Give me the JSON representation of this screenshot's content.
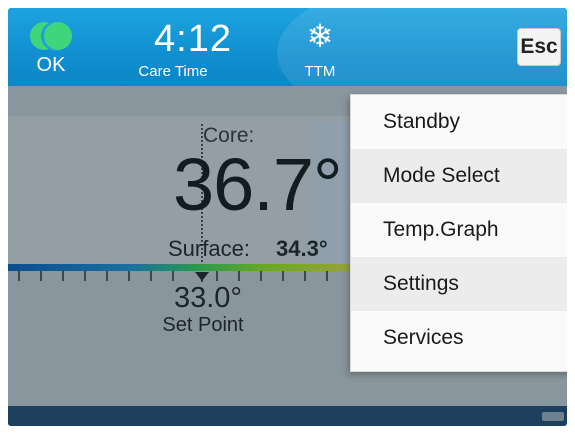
{
  "header": {
    "status_label": "OK",
    "care_time": "4:12",
    "care_time_label": "Care Time",
    "mode_icon": "snowflake-icon",
    "mode_symbol": "❄",
    "mode_label": "TTM",
    "esc_label": "Esc"
  },
  "temps": {
    "core_label": "Core:",
    "core_value": "36.7°",
    "surface_label": "Surface:",
    "surface_value": "34.3°",
    "setpoint_value": "33.0°",
    "setpoint_label": "Set Point"
  },
  "menu": {
    "items": [
      {
        "label": "Standby"
      },
      {
        "label": "Mode Select"
      },
      {
        "label": "Temp.Graph"
      },
      {
        "label": "Settings"
      },
      {
        "label": "Services"
      }
    ]
  },
  "colors": {
    "header": "#108fd0",
    "status_ok": "#3fd57a",
    "overlay": "#8a969d",
    "footer": "#1b3f5c",
    "menu_bg": "#fafafa"
  }
}
